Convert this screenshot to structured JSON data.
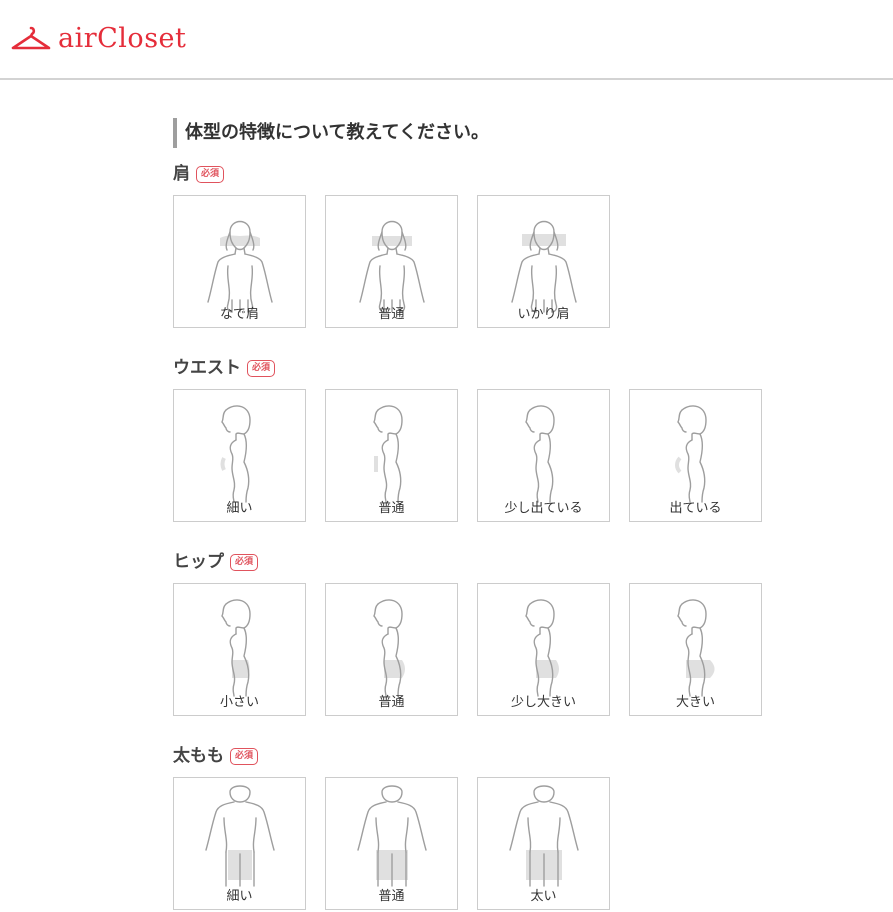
{
  "header": {
    "logo_text": "airCloset"
  },
  "page": {
    "title": "体型の特徴について教えてください。"
  },
  "sections": [
    {
      "label": "肩",
      "badge": "必須",
      "options": [
        "なで肩",
        "普通",
        "いかり肩"
      ]
    },
    {
      "label": "ウエスト",
      "badge": "必須",
      "options": [
        "細い",
        "普通",
        "少し出ている",
        "出ている"
      ]
    },
    {
      "label": "ヒップ",
      "badge": "必須",
      "options": [
        "小さい",
        "普通",
        "少し大きい",
        "大きい"
      ]
    },
    {
      "label": "太もも",
      "badge": "必須",
      "options": [
        "細い",
        "普通",
        "太い"
      ]
    }
  ],
  "colors": {
    "brand": "#e52d3a",
    "badge": "#e0535d",
    "border": "#cccccc",
    "highlight": "#e0e0e0"
  }
}
